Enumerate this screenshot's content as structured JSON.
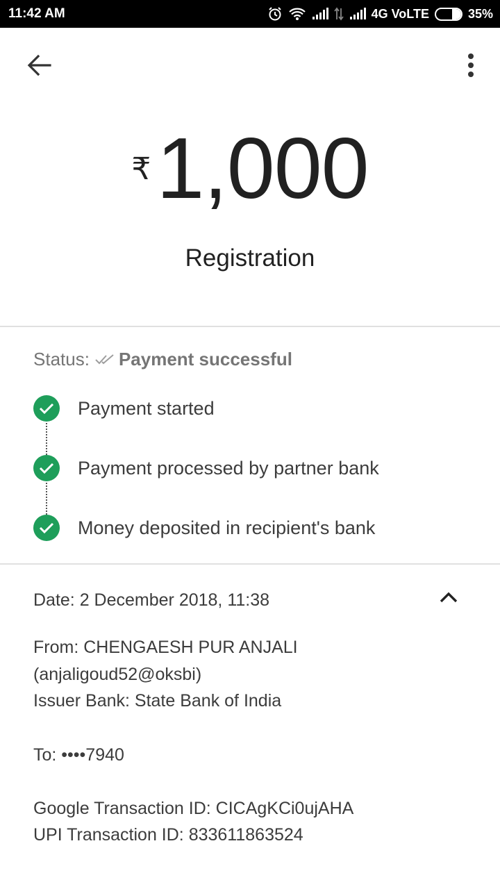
{
  "status_bar": {
    "time": "11:42 AM",
    "network_label": "4G VoLTE",
    "battery_text": "35%",
    "battery_level": 0.35,
    "icons": [
      "alarm-icon",
      "wifi-icon",
      "signal-icon",
      "data-arrows-icon",
      "signal-icon",
      "battery-icon"
    ]
  },
  "app_bar": {
    "back_icon": "arrow-left-icon",
    "menu_icon": "more-vert-icon"
  },
  "payment": {
    "currency_symbol": "₹",
    "amount": "1,000",
    "note": "Registration"
  },
  "status": {
    "label": "Status:",
    "value": "Payment successful",
    "icon": "double-check-icon",
    "steps": [
      {
        "text": "Payment started",
        "icon": "check-circle-icon"
      },
      {
        "text": "Payment processed by partner bank",
        "icon": "check-circle-icon"
      },
      {
        "text": "Money deposited in recipient's bank",
        "icon": "check-circle-icon"
      }
    ]
  },
  "details": {
    "date": "Date: 2 December 2018, 11:38",
    "from_line1": "From: CHENGAESH PUR  ANJALI",
    "from_line2": "(anjaligoud52@oksbi)",
    "issuer_bank": "Issuer Bank: State Bank of India",
    "to": "To: ••••7940",
    "google_txn_id": "Google Transaction ID: CICAgKCi0ujAHA",
    "upi_txn_id": "UPI Transaction ID: 833611863524",
    "collapse_icon": "chevron-up-icon"
  },
  "colors": {
    "success_green": "#1e9e5a",
    "status_text": "#757575",
    "divider": "#e0e0e0"
  }
}
